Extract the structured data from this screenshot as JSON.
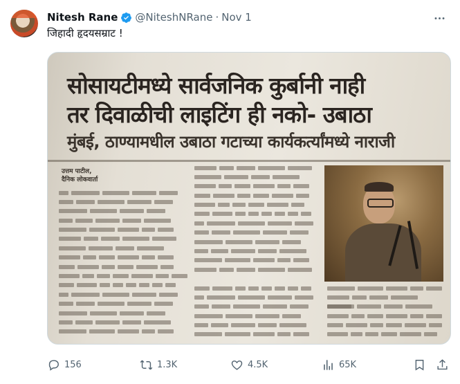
{
  "tweet": {
    "author_name": "Nitesh Rane",
    "handle": "@NiteshNRane",
    "separator": "·",
    "date": "Nov 1",
    "text": "जिहादी हृदयसम्राट !",
    "more_icon": "more-horizontal-icon",
    "verified_icon": "verified-badge-icon",
    "accent_color": "#1d9bf0"
  },
  "media": {
    "headline_line1": "सोसायटीमध्ये सार्वजनिक कुर्बानी नाही",
    "headline_line2": "तर दिवाळीची लाइटिंग ही नको- उबाठा",
    "subheadline": "मुंबई, ठाण्यामधील उबाठा गटाच्या कार्यकर्त्यांमध्ये नाराजी",
    "byline_name": "उत्तम पाटील,",
    "byline_paper": "दैनिक लोकवार्ता"
  },
  "actions": {
    "replies": "156",
    "reposts": "1.3K",
    "likes": "4.5K",
    "views": "65K"
  }
}
